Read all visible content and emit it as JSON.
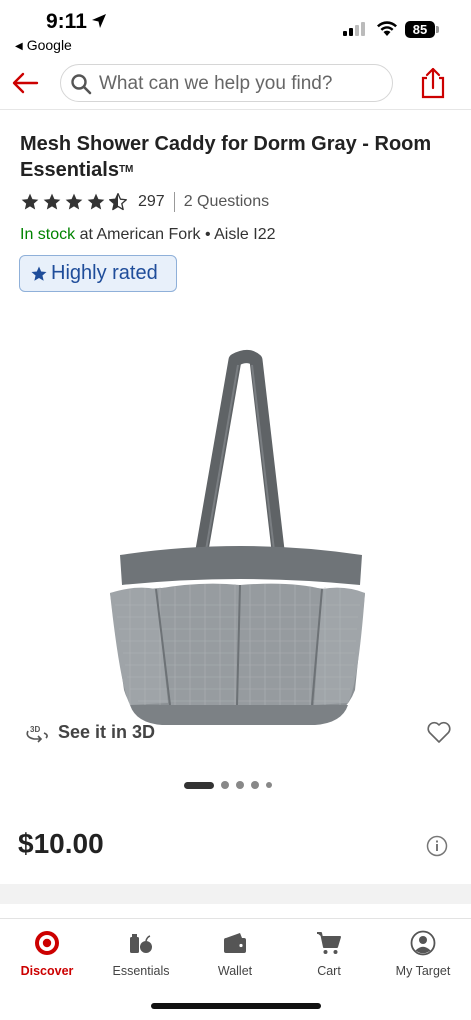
{
  "status_bar": {
    "time": "9:11",
    "back_app": "Google",
    "battery": "85"
  },
  "header": {
    "search_placeholder": "What can we help you find?"
  },
  "product": {
    "title": "Mesh Shower Caddy for Dorm Gray - Room Essentials",
    "title_mark": "TM",
    "rating_value": 4.5,
    "rating_count": "297",
    "questions": "2 Questions",
    "stock_status": "In stock",
    "stock_location": " at American Fork • Aisle I22",
    "badge": "Highly rated",
    "see_3d": "See it in 3D",
    "price": "$10.00",
    "image_count": 5,
    "current_image": 1
  },
  "tabs": [
    {
      "label": "Discover",
      "icon": "target-logo-icon",
      "active": true
    },
    {
      "label": "Essentials",
      "icon": "essentials-icon",
      "active": false
    },
    {
      "label": "Wallet",
      "icon": "wallet-icon",
      "active": false
    },
    {
      "label": "Cart",
      "icon": "cart-icon",
      "active": false
    },
    {
      "label": "My Target",
      "icon": "profile-icon",
      "active": false
    }
  ],
  "colors": {
    "brand_red": "#cc0000",
    "stock_green": "#008300",
    "badge_blue": "#1f4d9a"
  }
}
